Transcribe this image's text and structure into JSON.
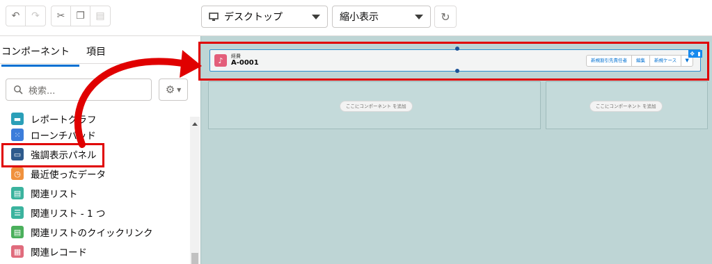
{
  "toolbar": {
    "undo_icon": "undo-icon",
    "redo_icon": "redo-icon",
    "cut_icon": "cut-icon",
    "copy_icon": "copy-icon",
    "paste_icon": "paste-icon",
    "device_select": "デスクトップ",
    "zoom_select": "縮小表示",
    "refresh_icon": "refresh-icon"
  },
  "left_panel": {
    "tabs": [
      {
        "label": "コンポーネント",
        "active": true
      },
      {
        "label": "項目",
        "active": false
      }
    ],
    "search": {
      "placeholder": "検索..."
    },
    "components": [
      {
        "label": "レポートグラフ",
        "color": "#2a9fb8"
      },
      {
        "label": "ローンチパッド",
        "color": "#3c7ddb"
      },
      {
        "label": "強調表示パネル",
        "color": "#2e5a8c"
      },
      {
        "label": "最近使ったデータ",
        "color": "#f0913d"
      },
      {
        "label": "関連リスト",
        "color": "#3bb39e"
      },
      {
        "label": "関連リスト - 1 つ",
        "color": "#3bb39e"
      },
      {
        "label": "関連リストのクイックリンク",
        "color": "#4bb05c"
      },
      {
        "label": "関連レコード",
        "color": "#e06b7c"
      }
    ]
  },
  "canvas": {
    "highlight_panel": {
      "object_label": "経費",
      "record_name": "A-0001",
      "actions": [
        "新規割引先責任者",
        "編集",
        "新規ケース"
      ]
    },
    "regions": [
      {
        "add_label": "ここにコンポーネント を追加"
      },
      {
        "add_label": "ここにコンポーネント を追加"
      }
    ]
  },
  "colors": {
    "annotation": "#e00000",
    "canvas_bg": "#bed5d5",
    "brand": "#0070d2"
  }
}
